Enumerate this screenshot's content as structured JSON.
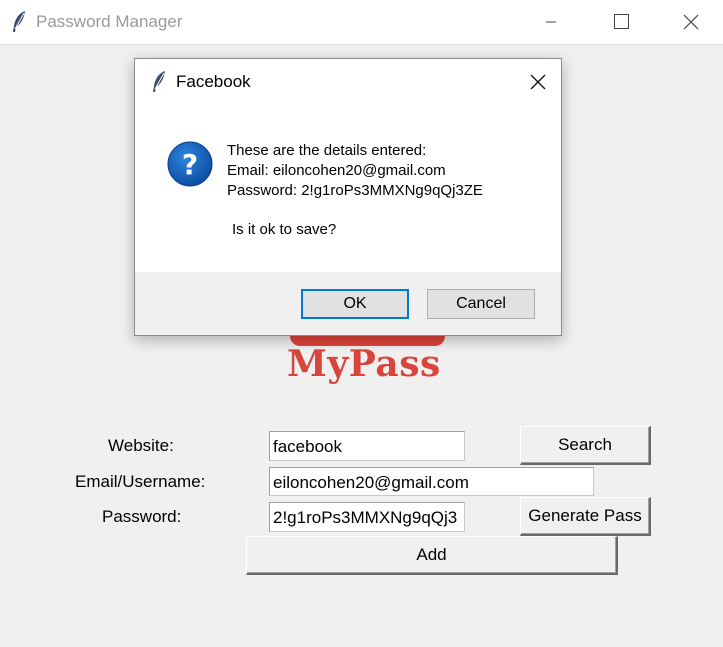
{
  "window": {
    "title": "Password Manager"
  },
  "logo": {
    "text": "MyPass"
  },
  "form": {
    "website_label": "Website:",
    "website_value": "facebook",
    "email_label": "Email/Username:",
    "email_value": "eiloncohen20@gmail.com",
    "password_label": "Password:",
    "password_value": "2!g1roPs3MMXNg9qQj3",
    "search_button": "Search",
    "generate_button": "Generate Pass",
    "add_button": "Add"
  },
  "dialog": {
    "title": "Facebook",
    "line1": "These are the details entered:",
    "line2": "Email: eiloncohen20@gmail.com",
    "line3": "Password: 2!g1roPs3MMXNg9qQj3ZE",
    "line4": "Is it ok to save?",
    "ok_button": "OK",
    "cancel_button": "Cancel"
  },
  "icons": {
    "app": "feather-icon",
    "question": "question-icon"
  },
  "colors": {
    "logo_red": "#d9453c",
    "question_blue": "#1565c0",
    "focus_blue": "#0078d7"
  }
}
